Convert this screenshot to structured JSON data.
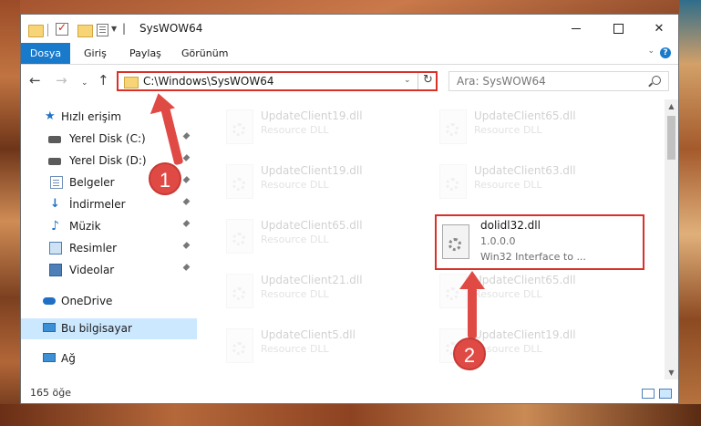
{
  "titlebar": {
    "title": "SysWOW64"
  },
  "ribbon": {
    "tabs": [
      "Dosya",
      "Giriş",
      "Paylaş",
      "Görünüm"
    ]
  },
  "navbar": {
    "address": "C:\\Windows\\SysWOW64",
    "search_placeholder": "Ara: SysWOW64"
  },
  "sidebar": {
    "items": [
      {
        "label": "Hızlı erişim"
      },
      {
        "label": "Yerel Disk (C:)"
      },
      {
        "label": "Yerel Disk (D:)"
      },
      {
        "label": "Belgeler"
      },
      {
        "label": "İndirmeler"
      },
      {
        "label": "Müzik"
      },
      {
        "label": "Resimler"
      },
      {
        "label": "Videolar"
      },
      {
        "label": "OneDrive"
      },
      {
        "label": "Bu bilgisayar"
      },
      {
        "label": "Ağ"
      }
    ]
  },
  "files": [
    {
      "name": "UpdateClient19.dll",
      "desc": "Resource DLL"
    },
    {
      "name": "UpdateClient65.dll",
      "desc": "Resource DLL"
    },
    {
      "name": "UpdateClient19.dll",
      "desc": "Resource DLL"
    },
    {
      "name": "UpdateClient63.dll",
      "desc": "Resource DLL"
    },
    {
      "name": "UpdateClient65.dll",
      "desc": "Resource DLL"
    },
    {
      "name": "dolidl32.dll",
      "version": "1.0.0.0",
      "desc": "Win32 Interface to ..."
    },
    {
      "name": "UpdateClient21.dll",
      "desc": "Resource DLL"
    },
    {
      "name": "UpdateClient65.dll",
      "desc": "Resource DLL"
    },
    {
      "name": "UpdateClient5.dll",
      "desc": "Resource DLL"
    },
    {
      "name": "UpdateClient19.dll",
      "desc": "Resource DLL"
    }
  ],
  "statusbar": {
    "count": "165 öğe"
  },
  "annotations": {
    "step1": "1",
    "step2": "2",
    "color": "#e04a45"
  }
}
